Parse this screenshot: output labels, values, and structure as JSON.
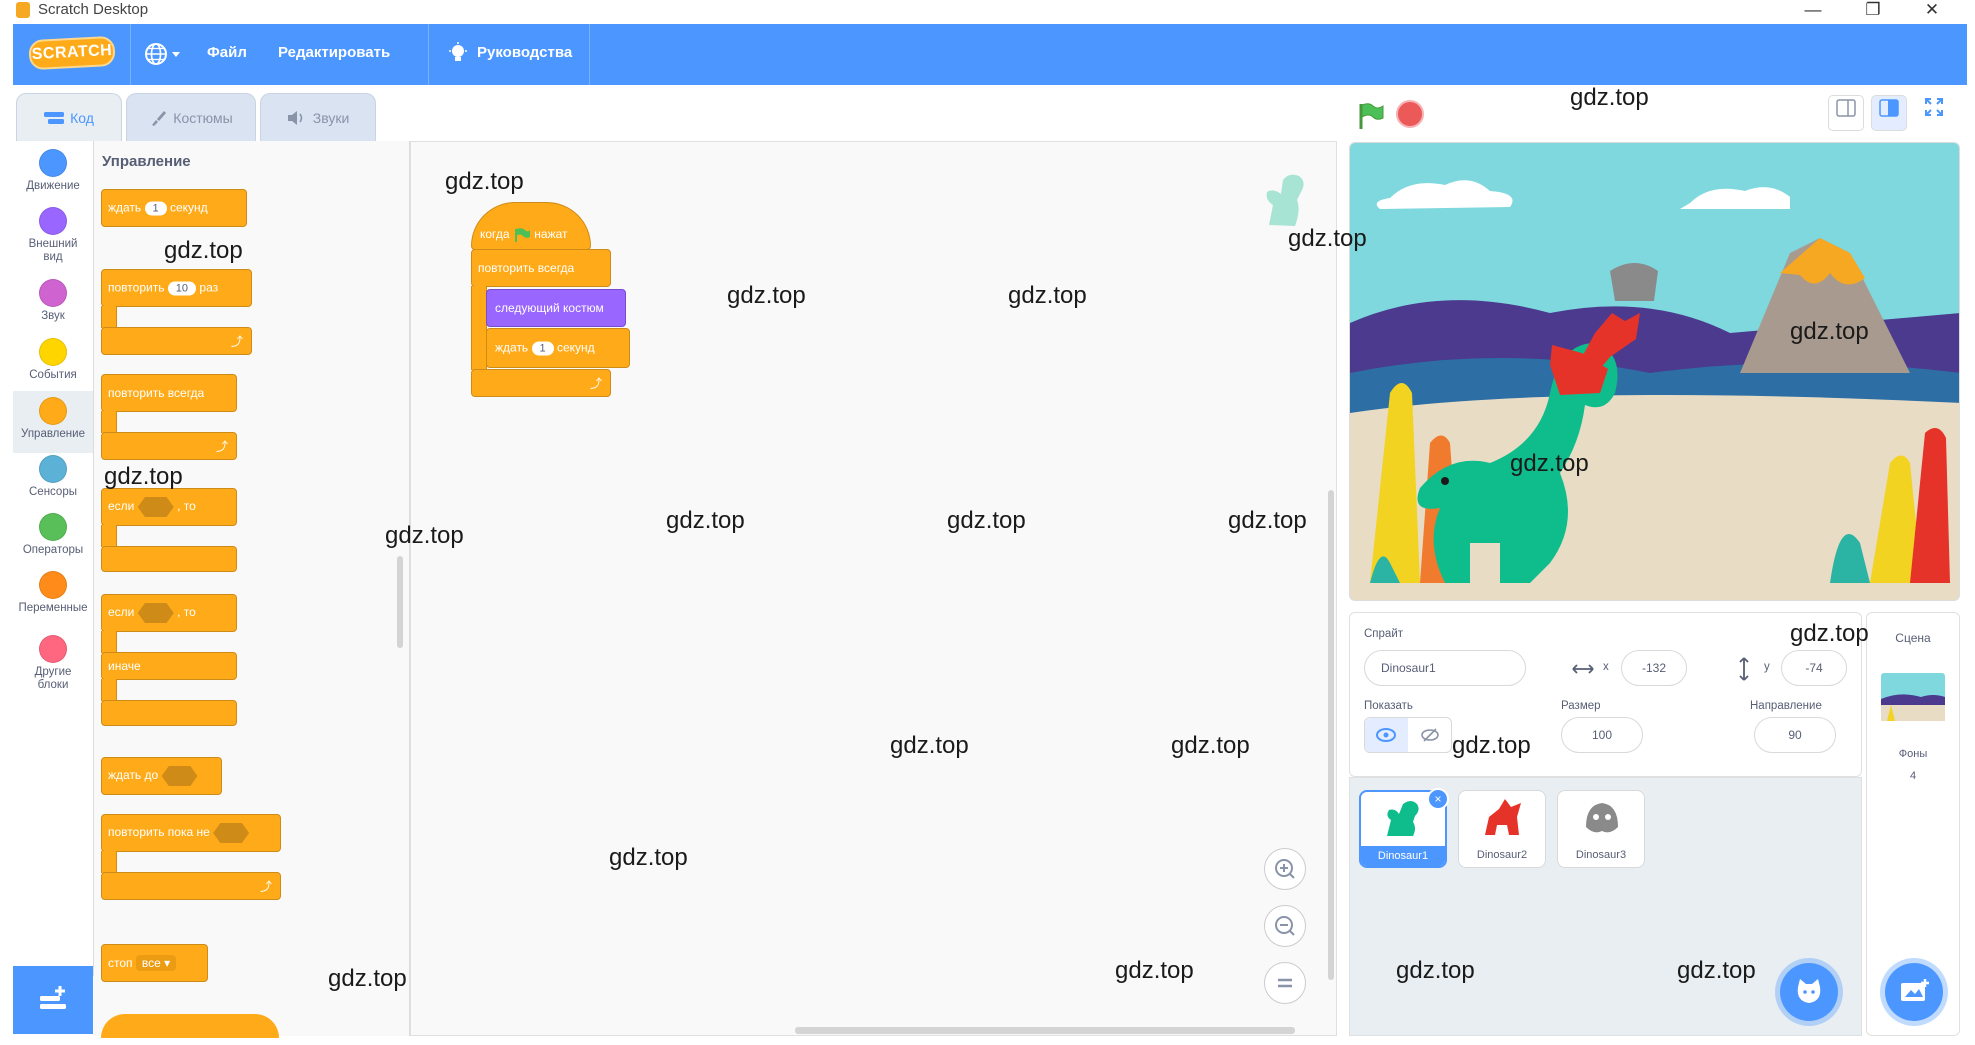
{
  "window": {
    "title": "Scratch Desktop",
    "controls": {
      "minimize": "—",
      "restore": "❐",
      "close": "✕"
    }
  },
  "menubar": {
    "logo": "SCRATCH",
    "items": [
      "Файл",
      "Редактировать",
      "Руководства"
    ]
  },
  "tabs": [
    {
      "label": "Код",
      "icon": "code-icon",
      "active": true
    },
    {
      "label": "Костюмы",
      "icon": "brush-icon",
      "active": false
    },
    {
      "label": "Звуки",
      "icon": "speaker-icon",
      "active": false
    }
  ],
  "categories": [
    {
      "label": "Движение",
      "color": "#4c97ff"
    },
    {
      "label": "Внешний вид",
      "color": "#9966ff"
    },
    {
      "label": "Звук",
      "color": "#cf63cf"
    },
    {
      "label": "События",
      "color": "#ffd500"
    },
    {
      "label": "Управление",
      "color": "#ffab19",
      "selected": true
    },
    {
      "label": "Сенсоры",
      "color": "#5cb1d6"
    },
    {
      "label": "Операторы",
      "color": "#59c059"
    },
    {
      "label": "Переменные",
      "color": "#ff8c1a"
    },
    {
      "label": "Другие блоки",
      "color": "#ff6680"
    }
  ],
  "flyout": {
    "heading": "Управление",
    "blocks": {
      "wait": {
        "pre": "ждать",
        "value": "1",
        "post": "секунд"
      },
      "repeat": {
        "pre": "повторить",
        "value": "10",
        "post": "раз"
      },
      "forever": "повторить всегда",
      "if_then": {
        "pre": "если",
        "post": ", то"
      },
      "if_else": {
        "pre": "если",
        "post": ", то",
        "else": "иначе"
      },
      "wait_until": "ждать до",
      "repeat_until": "повторить пока не",
      "stop": {
        "pre": "стоп",
        "option": "все"
      }
    }
  },
  "script": {
    "hat": {
      "pre": "когда",
      "post": "нажат"
    },
    "forever": "повторить всегда",
    "next_costume": "следующий костюм",
    "wait": {
      "pre": "ждать",
      "value": "1",
      "post": "секунд"
    }
  },
  "sprite_info": {
    "sprite_label": "Спрайт",
    "sprite_name": "Dinosaur1",
    "x_label": "x",
    "x_value": "-132",
    "y_label": "y",
    "y_value": "-74",
    "show_label": "Показать",
    "size_label": "Размер",
    "size_value": "100",
    "direction_label": "Направление",
    "direction_value": "90"
  },
  "sprites": [
    {
      "name": "Dinosaur1",
      "selected": true,
      "color": "#0fbd8c"
    },
    {
      "name": "Dinosaur2",
      "selected": false,
      "color": "#e6332a"
    },
    {
      "name": "Dinosaur3",
      "selected": false,
      "color": "#8a8a8a"
    }
  ],
  "stage_pane": {
    "label": "Сцена",
    "backdrops_label": "Фоны",
    "backdrops_count": "4"
  },
  "watermark": "gdz.top"
}
